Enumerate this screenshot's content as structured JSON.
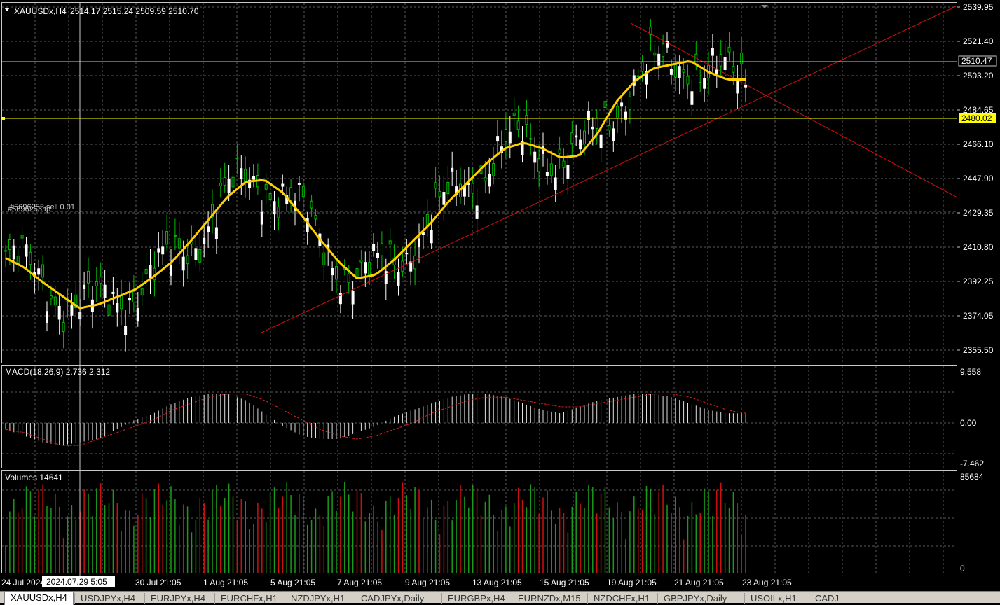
{
  "header": {
    "symbol_line": "XAUUSDx,H4",
    "ohlc": "2514.17 2515.24 2509.59 2510.70"
  },
  "main_axis": {
    "ticks": [
      "2539.95",
      "2521.40",
      "2503.20",
      "2484.65",
      "2466.10",
      "2447.90",
      "2429.35",
      "2410.80",
      "2392.25",
      "2374.05",
      "2355.50"
    ],
    "ymin": 2350,
    "ymax": 2540
  },
  "price_labels": {
    "bid": "2510.47",
    "level": "2480.02"
  },
  "order": {
    "label": "#5696253 sell 0.01",
    "label2": "#5696253 tp"
  },
  "macd": {
    "label": "MACD(18,26,9) 2.736 2.312",
    "ticks": [
      "9.558",
      "0.00",
      "-7.462"
    ]
  },
  "volumes": {
    "label": "Volumes 14641",
    "ticks": [
      "85684",
      "0"
    ]
  },
  "time_axis": {
    "labels": [
      "24 Jul 2024",
      "30 Jul 21:05",
      "1 Aug 21:05",
      "5 Aug 21:05",
      "7 Aug 21:05",
      "9 Aug 21:05",
      "13 Aug 21:05",
      "15 Aug 21:05",
      "19 Aug 21:05",
      "21 Aug 21:05",
      "23 Aug 21:05"
    ],
    "crosshair_time": "2024.07.29 5:05"
  },
  "colors": {
    "bull": "#00c000",
    "bear": "#ffffff",
    "ma": "#ffd000",
    "trendline": "#d01010",
    "grid": "#5a5a5a",
    "level": "#ffff00"
  },
  "tabs": [
    {
      "label": "XAUUSDx,H4",
      "active": true
    },
    {
      "label": "USDJPYx,H4",
      "active": false
    },
    {
      "label": "EURJPYx,H4",
      "active": false
    },
    {
      "label": "EURCHFx,H1",
      "active": false
    },
    {
      "label": "NZDJPYx,H1",
      "active": false
    },
    {
      "label": "CADJPYx,Daily",
      "active": false
    },
    {
      "label": "EURGBPx,H4",
      "active": false
    },
    {
      "label": "EURNZDx,M15",
      "active": false
    },
    {
      "label": "NZDCHFx,H1",
      "active": false
    },
    {
      "label": "GBPJPYx,Daily",
      "active": false
    },
    {
      "label": "USOILx,H1",
      "active": false
    },
    {
      "label": "CADJ",
      "active": false
    }
  ],
  "chart_data": {
    "type": "candlestick",
    "title": "XAUUSDx,H4",
    "ma_points": [
      2405,
      2400,
      2392,
      2385,
      2378,
      2380,
      2384,
      2388,
      2395,
      2403,
      2414,
      2426,
      2438,
      2446,
      2447,
      2440,
      2428,
      2415,
      2403,
      2394,
      2396,
      2404,
      2414,
      2424,
      2436,
      2446,
      2456,
      2464,
      2467,
      2464,
      2459,
      2460,
      2472,
      2489,
      2500,
      2507,
      2509,
      2511,
      2505,
      2501,
      2501
    ],
    "macd_hist": [
      -2,
      -4,
      -6,
      -7,
      -6,
      -5,
      -2,
      1,
      3,
      6,
      8,
      9,
      9,
      7,
      3,
      -1,
      -4,
      -5,
      -5,
      -3,
      -1,
      2,
      4,
      6,
      8,
      9,
      9,
      8,
      6,
      4,
      3,
      5,
      7,
      8,
      9,
      9,
      8,
      6,
      4,
      3,
      3
    ],
    "macd_signal": [
      -2,
      -3,
      -5,
      -7,
      -7,
      -5,
      -3,
      -1,
      1,
      4,
      6,
      8,
      9,
      9,
      7,
      4,
      1,
      -2,
      -4,
      -5,
      -4,
      -2,
      0,
      3,
      5,
      7,
      8,
      8,
      7,
      6,
      5,
      5,
      6,
      7,
      8,
      9,
      9,
      8,
      6,
      4,
      3
    ],
    "volume_max": 85684
  }
}
